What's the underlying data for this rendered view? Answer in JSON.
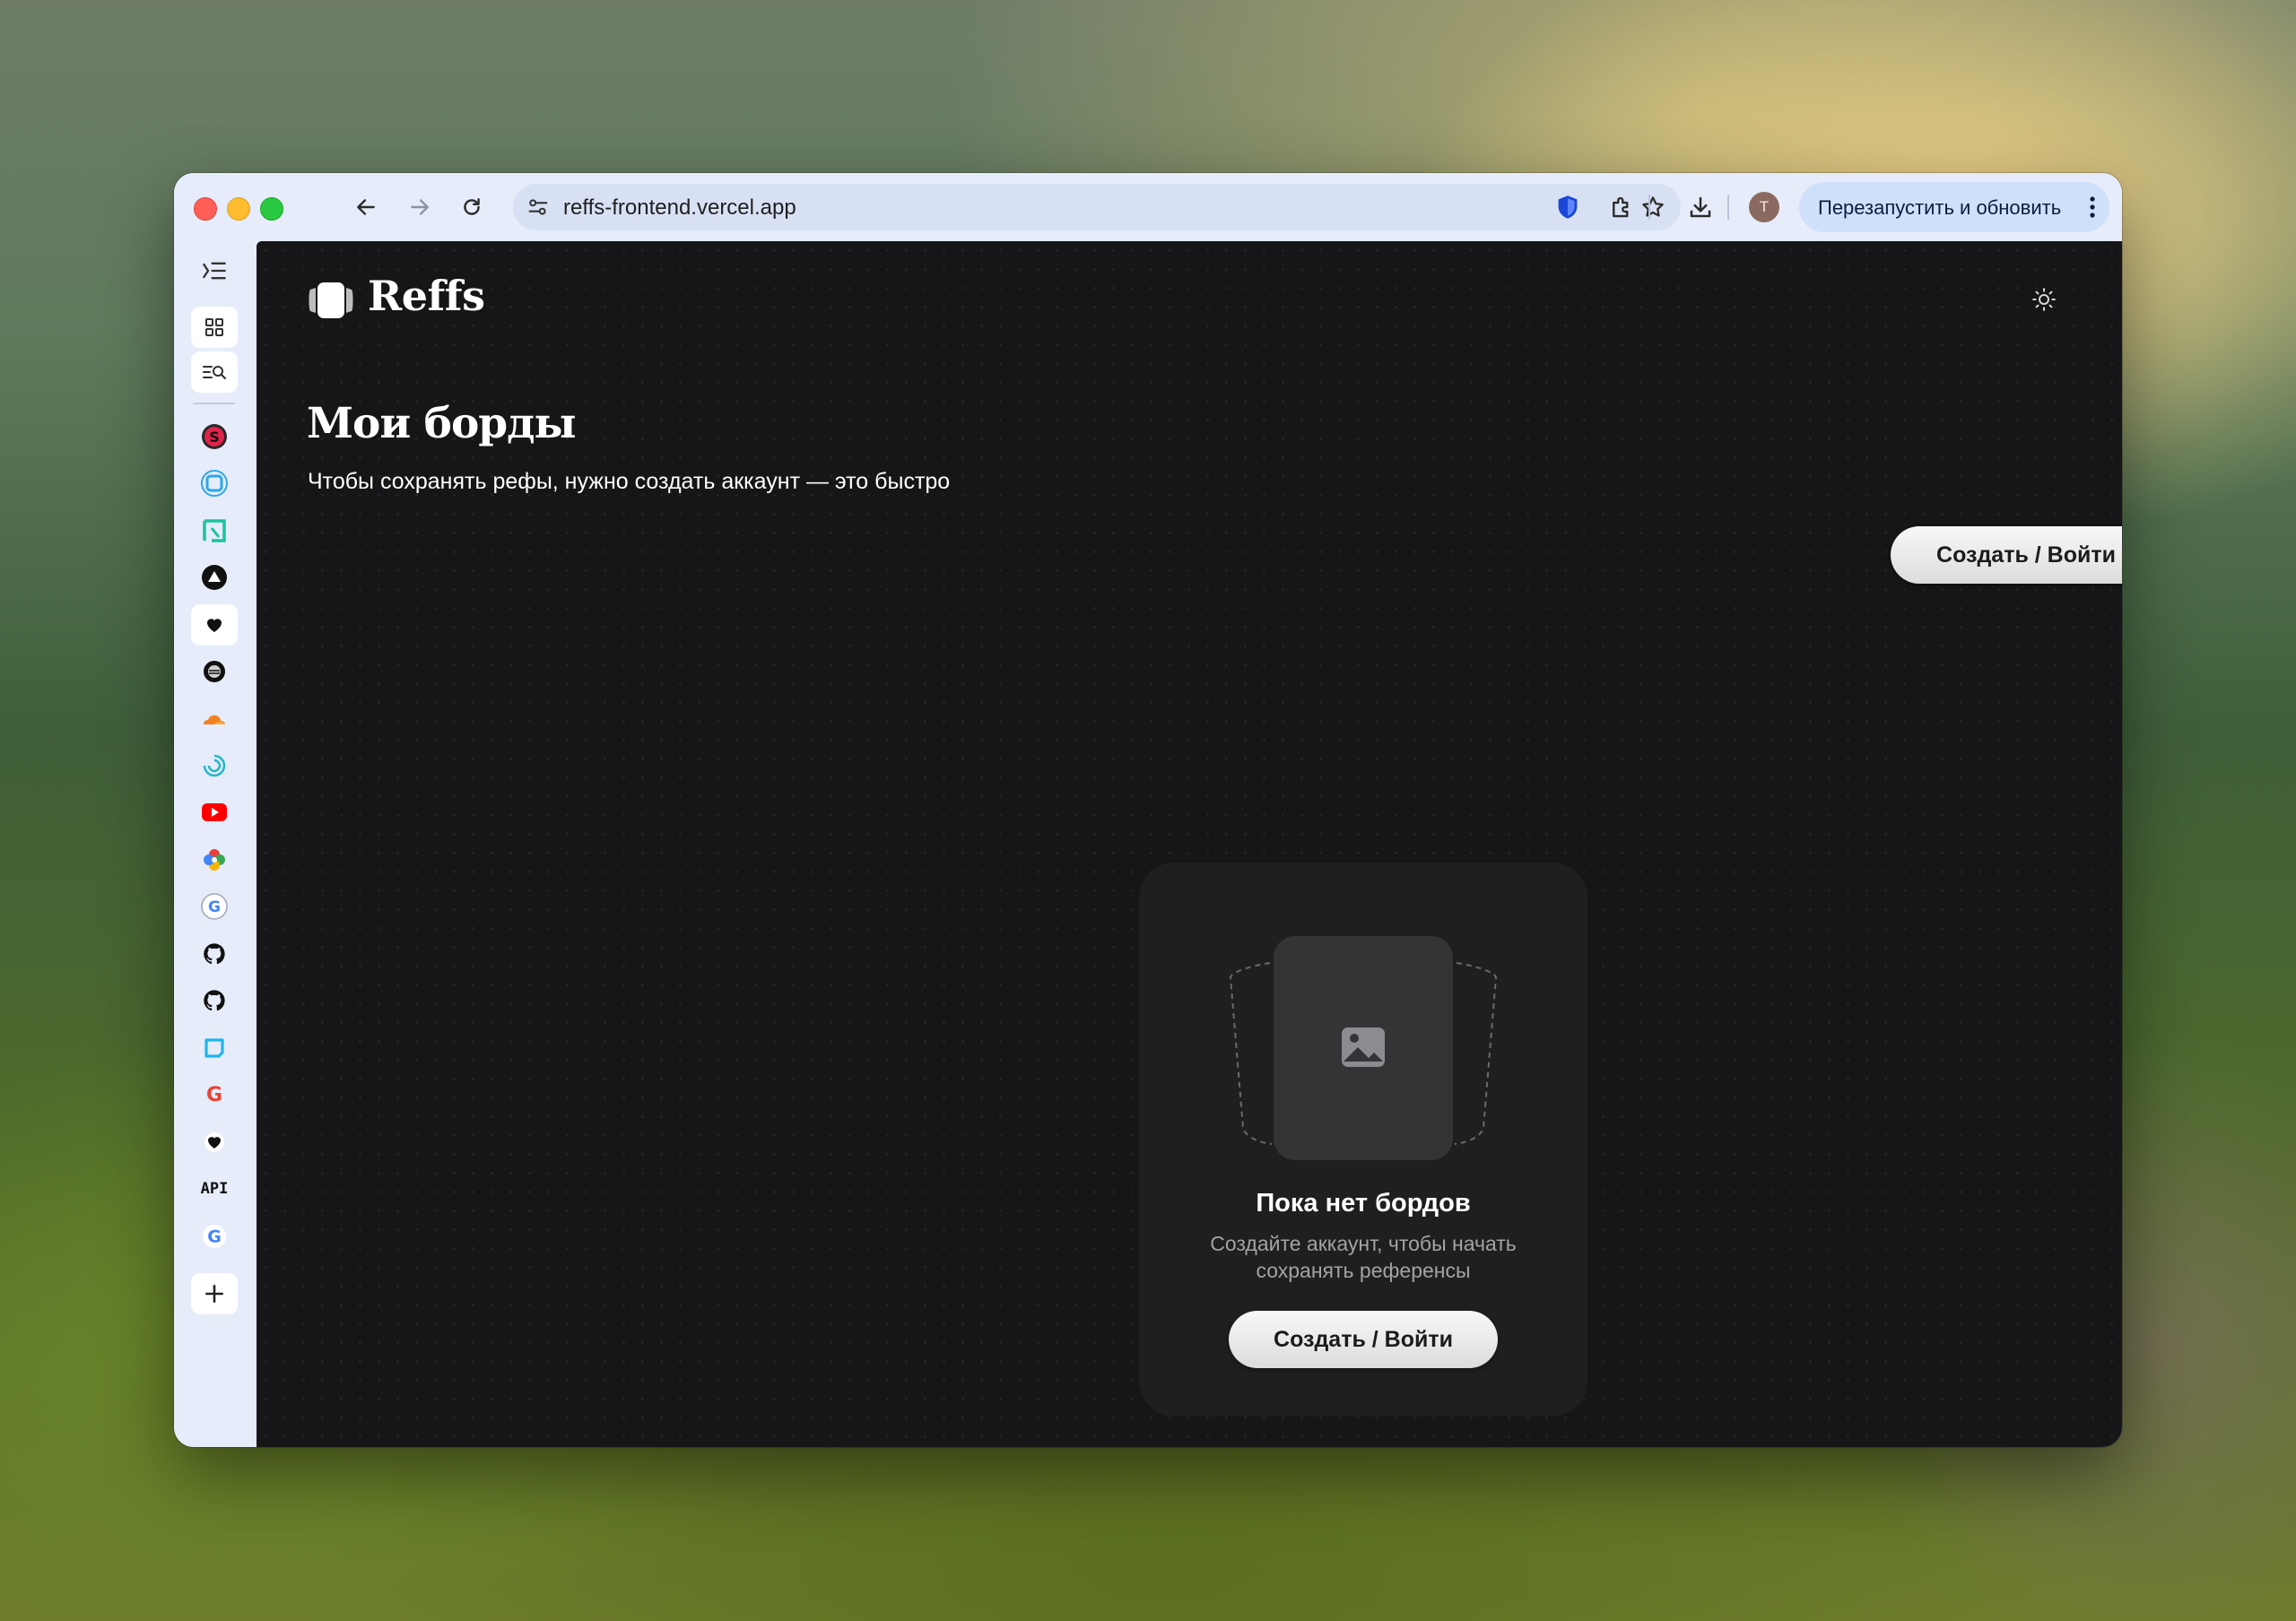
{
  "browser": {
    "url": "reffs-frontend.vercel.app",
    "profile_initial": "T",
    "relaunch_label": "Перезапустить и обновить",
    "toolbar_icons": [
      "back-icon",
      "forward-icon",
      "reload-icon",
      "site-settings-icon",
      "star-icon",
      "shield-extension-icon",
      "extensions-icon",
      "download-icon",
      "more-icon"
    ]
  },
  "sidebar": {
    "items": [
      "sidebar-toggle-icon",
      "grid-icon",
      "search-list-icon",
      "app-s-icon",
      "app-square-icon",
      "app-notion-icon",
      "app-triangle-icon",
      "app-heart-icon",
      "app-dots-icon",
      "cloudflare-icon",
      "app-swirl-icon",
      "youtube-icon",
      "app-flower-icon",
      "google-icon",
      "github-icon",
      "github-icon",
      "app-blue-square-icon",
      "google-icon",
      "app-heart-icon",
      "api-icon",
      "google-icon",
      "add-icon"
    ],
    "api_label": "API"
  },
  "app": {
    "logo_text": "Reffs",
    "title": "Мои борды",
    "subtitle": "Чтобы сохранять рефы, нужно создать аккаунт — это быстро",
    "cta_label": "Создать / Войти",
    "empty_state": {
      "title": "Пока нет бордов",
      "text": "Создайте аккаунт, чтобы начать сохранять референсы",
      "button_label": "Создать / Войти"
    }
  },
  "colors": {
    "app_background": "#161618",
    "card_background": "#1f1f21",
    "chrome_background": "#e6ecf9",
    "relaunch_button": "#cfe0fb"
  }
}
